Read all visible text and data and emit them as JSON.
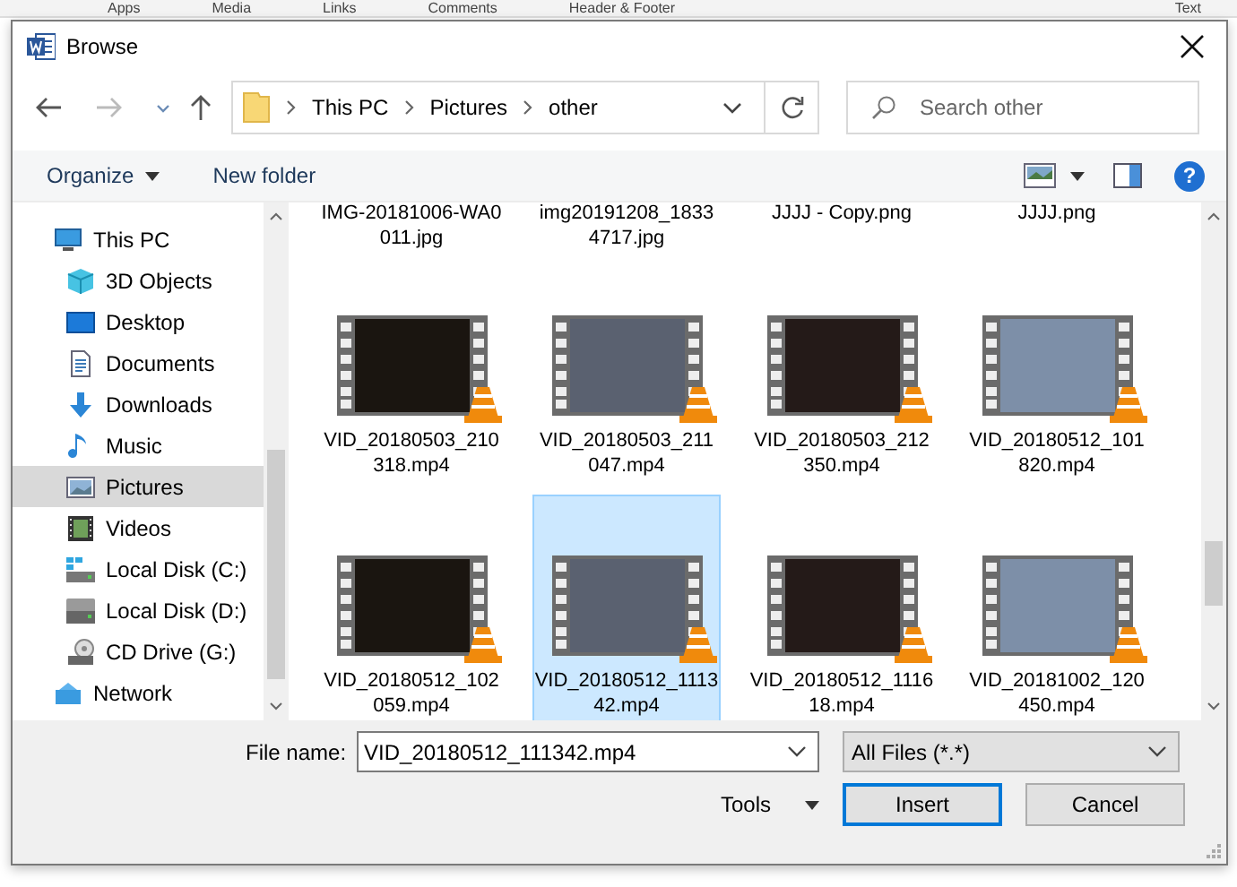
{
  "background_ribbon": [
    "Apps",
    "Media",
    "Links",
    "Comments",
    "Header & Footer",
    "Text"
  ],
  "window": {
    "title": "Browse"
  },
  "address": {
    "crumbs": [
      "This PC",
      "Pictures",
      "other"
    ]
  },
  "search": {
    "placeholder": "Search other"
  },
  "toolbar": {
    "organize": "Organize",
    "new_folder": "New folder",
    "help": "?"
  },
  "nav_items": [
    {
      "label": "This PC",
      "kind": "pc",
      "selected": false,
      "children": [
        {
          "label": "3D Objects",
          "kind": "cube",
          "selected": false
        },
        {
          "label": "Desktop",
          "kind": "desktop",
          "selected": false
        },
        {
          "label": "Documents",
          "kind": "document",
          "selected": false
        },
        {
          "label": "Downloads",
          "kind": "download",
          "selected": false
        },
        {
          "label": "Music",
          "kind": "music",
          "selected": false
        },
        {
          "label": "Pictures",
          "kind": "pictures",
          "selected": true
        },
        {
          "label": "Videos",
          "kind": "videos",
          "selected": false
        },
        {
          "label": "Local Disk (C:)",
          "kind": "system",
          "selected": false
        },
        {
          "label": "Local Disk (D:)",
          "kind": "disk",
          "selected": false
        },
        {
          "label": "CD Drive (G:)",
          "kind": "cd",
          "selected": false
        }
      ]
    },
    {
      "label": "Network",
      "kind": "network",
      "selected": false
    }
  ],
  "files": [
    {
      "name": "IMG-20181006-WA0011.jpg",
      "kind": "image",
      "selected": false
    },
    {
      "name": "img20191208_18334717.jpg",
      "kind": "image",
      "selected": false
    },
    {
      "name": "JJJJ - Copy.png",
      "kind": "image",
      "selected": false
    },
    {
      "name": "JJJJ.png",
      "kind": "image",
      "selected": false
    },
    {
      "name": "VID_20180503_210318.mp4",
      "kind": "video",
      "selected": false
    },
    {
      "name": "VID_20180503_211047.mp4",
      "kind": "video",
      "selected": false
    },
    {
      "name": "VID_20180503_212350.mp4",
      "kind": "video",
      "selected": false
    },
    {
      "name": "VID_20180512_101820.mp4",
      "kind": "video",
      "selected": false
    },
    {
      "name": "VID_20180512_102059.mp4",
      "kind": "video",
      "selected": false
    },
    {
      "name": "VID_20180512_111342.mp4",
      "kind": "video",
      "selected": true
    },
    {
      "name": "VID_20180512_111618.mp4",
      "kind": "video",
      "selected": false
    },
    {
      "name": "VID_20181002_120450.mp4",
      "kind": "video",
      "selected": false
    }
  ],
  "file_name": {
    "label": "File name:",
    "value": "VID_20180512_111342.mp4"
  },
  "file_type": {
    "value": "All Files (*.*)"
  },
  "buttons": {
    "tools": "Tools",
    "insert": "Insert",
    "cancel": "Cancel"
  }
}
